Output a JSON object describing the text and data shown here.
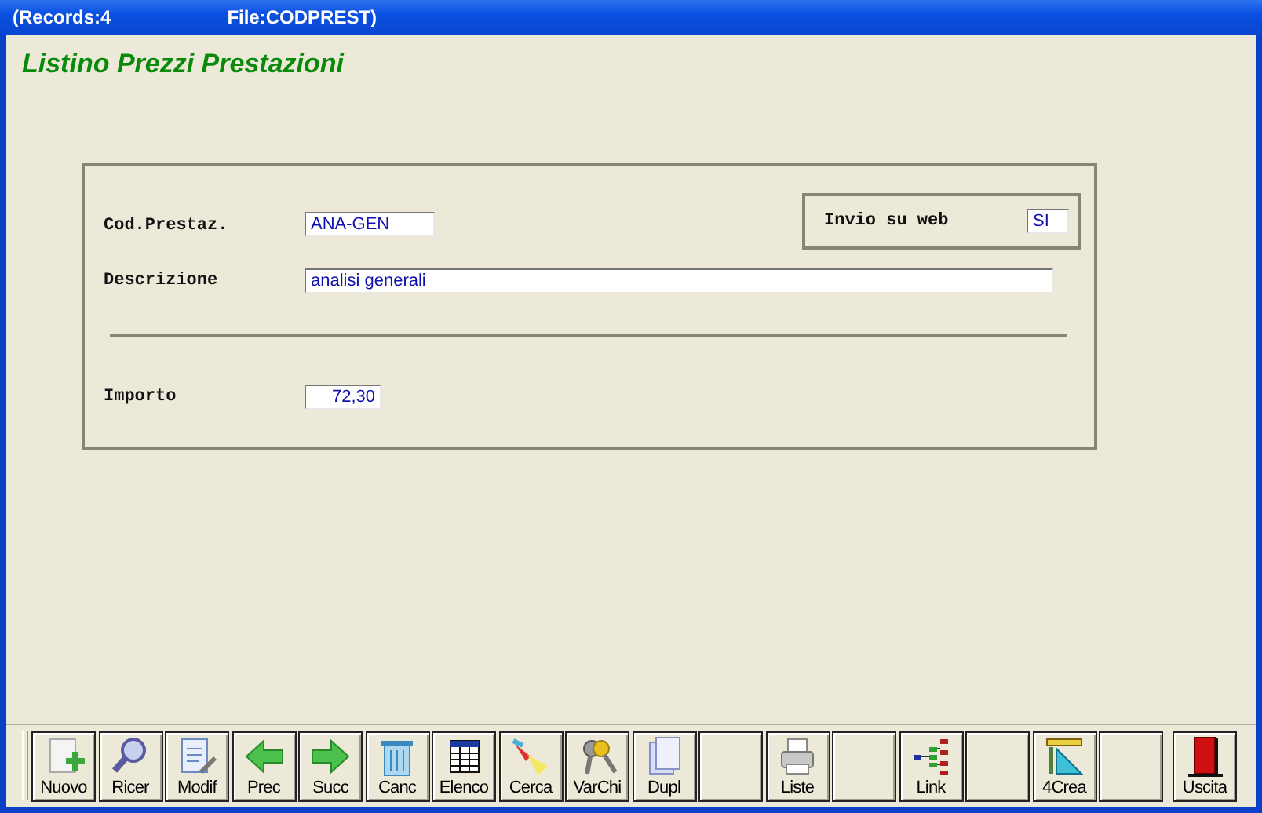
{
  "window": {
    "records": "(Records:4",
    "file": "File:CODPREST)"
  },
  "heading": "Listino Prezzi Prestazioni",
  "form": {
    "code": {
      "label": "Cod.Prestaz.",
      "value": "ANA-GEN"
    },
    "web": {
      "label": "Invio su web",
      "value": "SI"
    },
    "description": {
      "label": "Descrizione",
      "value": "analisi generali"
    },
    "amount": {
      "label": "Importo",
      "value": "72,30"
    }
  },
  "toolbar": [
    {
      "kind": "action",
      "label": "Nuovo"
    },
    {
      "kind": "action",
      "label": "Ricer"
    },
    {
      "kind": "action",
      "label": "Modif"
    },
    {
      "kind": "action",
      "label": "Prec"
    },
    {
      "kind": "action",
      "label": "Succ"
    },
    {
      "kind": "action",
      "label": "Canc"
    },
    {
      "kind": "action",
      "label": "Elenco"
    },
    {
      "kind": "action",
      "label": "Cerca"
    },
    {
      "kind": "action",
      "label": "VarChi"
    },
    {
      "kind": "action",
      "label": "Dupl"
    },
    {
      "kind": "blank"
    },
    {
      "kind": "action",
      "label": "Liste"
    },
    {
      "kind": "blank"
    },
    {
      "kind": "action",
      "label": "Link"
    },
    {
      "kind": "blank"
    },
    {
      "kind": "action",
      "label": "4Crea"
    },
    {
      "kind": "blank"
    },
    {
      "kind": "exit",
      "label": "Uscita"
    }
  ]
}
